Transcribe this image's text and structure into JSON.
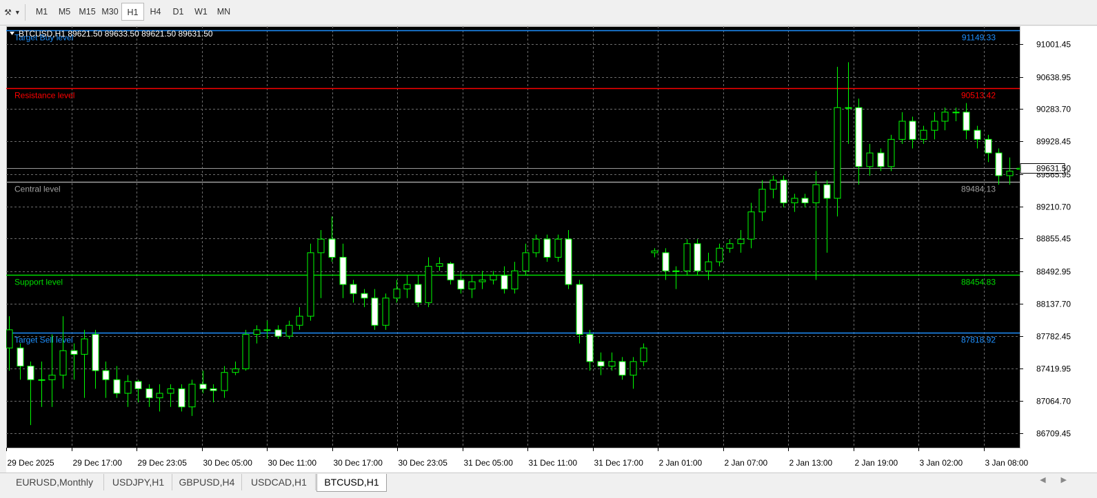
{
  "toolbar": {
    "tool_icon": "drawing-tools-icon",
    "timeframes": [
      "M1",
      "M5",
      "M15",
      "M30",
      "H1",
      "H4",
      "D1",
      "W1",
      "MN"
    ],
    "active_timeframe": "H1"
  },
  "chart_data": {
    "type": "candlestick",
    "symbol_header": "BTCUSD,H1  89621.50 89633.50 89621.50 89631.50",
    "current_price_label": "89631.50",
    "ylim": [
      86550,
      91160
    ],
    "y_ticks": [
      "91001.45",
      "90638.95",
      "90283.70",
      "89928.45",
      "89565.95",
      "89210.70",
      "88855.45",
      "88492.95",
      "88137.70",
      "87782.45",
      "87419.95",
      "87064.70",
      "86709.45"
    ],
    "x_ticks": [
      "29 Dec 2025",
      "29 Dec 17:00",
      "29 Dec 23:05",
      "30 Dec 05:00",
      "30 Dec 11:00",
      "30 Dec 17:00",
      "30 Dec 23:05",
      "31 Dec 05:00",
      "31 Dec 11:00",
      "31 Dec 17:00",
      "2 Jan 01:00",
      "2 Jan 07:00",
      "2 Jan 13:00",
      "2 Jan 19:00",
      "3 Jan 02:00",
      "3 Jan 08:00"
    ],
    "levels": [
      {
        "label": "Target Buy level",
        "value_text": "91149.33",
        "value": 91149.33,
        "color": "#1e90ff"
      },
      {
        "label": "Resistance level",
        "value_text": "90513.42",
        "value": 90513.42,
        "color": "#ff0000"
      },
      {
        "label": "Central level",
        "value_text": "89484.13",
        "value": 89484.13,
        "color": "#a0a0a0"
      },
      {
        "label": "Support level",
        "value_text": "88454.83",
        "value": 88454.83,
        "color": "#00dd00"
      },
      {
        "label": "Target Sell level",
        "value_text": "87818.92",
        "value": 87818.92,
        "color": "#1e90ff"
      }
    ],
    "candles": [
      [
        87650,
        87850,
        88000,
        87400
      ],
      [
        87650,
        87450,
        87700,
        87300
      ],
      [
        87450,
        87300,
        87500,
        86800
      ],
      [
        87300,
        87300,
        87500,
        87000
      ],
      [
        87300,
        87350,
        87800,
        87000
      ],
      [
        87350,
        87620,
        88000,
        87200
      ],
      [
        87620,
        87580,
        87700,
        87300
      ],
      [
        87580,
        87750,
        87850,
        87100
      ],
      [
        87800,
        87400,
        87850,
        87200
      ],
      [
        87400,
        87300,
        87500,
        87100
      ],
      [
        87300,
        87150,
        87450,
        87100
      ],
      [
        87150,
        87280,
        87350,
        87000
      ],
      [
        87280,
        87200,
        87300,
        87050
      ],
      [
        87200,
        87100,
        87250,
        87000
      ],
      [
        87100,
        87150,
        87250,
        86950
      ],
      [
        87150,
        87200,
        87250,
        87000
      ],
      [
        87200,
        87000,
        87250,
        86950
      ],
      [
        87000,
        87250,
        87300,
        86900
      ],
      [
        87250,
        87200,
        87400,
        87150
      ],
      [
        87200,
        87180,
        87250,
        87050
      ],
      [
        87180,
        87380,
        87450,
        87100
      ],
      [
        87380,
        87420,
        87500,
        87350
      ],
      [
        87420,
        87800,
        87850,
        87400
      ],
      [
        87800,
        87850,
        87900,
        87700
      ],
      [
        87850,
        87850,
        87950,
        87750
      ],
      [
        87850,
        87780,
        87900,
        87750
      ],
      [
        87780,
        87900,
        87950,
        87750
      ],
      [
        87900,
        88000,
        88100,
        87850
      ],
      [
        88000,
        88700,
        88800,
        87950
      ],
      [
        88700,
        88850,
        88950,
        88200
      ],
      [
        88850,
        88650,
        89100,
        88600
      ],
      [
        88650,
        88350,
        88800,
        88200
      ],
      [
        88350,
        88250,
        88400,
        88150
      ],
      [
        88250,
        88200,
        88300,
        88100
      ],
      [
        88200,
        87900,
        88300,
        87850
      ],
      [
        87900,
        88200,
        88250,
        87850
      ],
      [
        88200,
        88300,
        88400,
        88150
      ],
      [
        88300,
        88350,
        88450,
        88200
      ],
      [
        88350,
        88150,
        88450,
        88100
      ],
      [
        88150,
        88550,
        88650,
        88100
      ],
      [
        88550,
        88580,
        88650,
        88500
      ],
      [
        88580,
        88400,
        88600,
        88350
      ],
      [
        88400,
        88300,
        88500,
        88250
      ],
      [
        88300,
        88380,
        88450,
        88200
      ],
      [
        88380,
        88400,
        88500,
        88300
      ],
      [
        88400,
        88450,
        88500,
        88350
      ],
      [
        88450,
        88300,
        88550,
        88250
      ],
      [
        88300,
        88500,
        88600,
        88250
      ],
      [
        88500,
        88700,
        88800,
        88450
      ],
      [
        88700,
        88850,
        88900,
        88650
      ],
      [
        88850,
        88650,
        88900,
        88600
      ],
      [
        88650,
        88850,
        88900,
        88600
      ],
      [
        88850,
        88350,
        88950,
        88300
      ],
      [
        88350,
        87800,
        88400,
        87700
      ],
      [
        87800,
        87500,
        87850,
        87400
      ],
      [
        87500,
        87450,
        87600,
        87350
      ],
      [
        87450,
        87500,
        87600,
        87400
      ],
      [
        87500,
        87350,
        87550,
        87300
      ],
      [
        87350,
        87500,
        87550,
        87200
      ],
      [
        87500,
        87650,
        87700,
        87450
      ],
      [
        88700,
        88720,
        88750,
        88650
      ],
      [
        88700,
        88500,
        88750,
        88400
      ],
      [
        88500,
        88500,
        88550,
        88300
      ],
      [
        88500,
        88800,
        88850,
        88450
      ],
      [
        88800,
        88500,
        88850,
        88450
      ],
      [
        88500,
        88600,
        88700,
        88400
      ],
      [
        88600,
        88750,
        88800,
        88550
      ],
      [
        88750,
        88800,
        88850,
        88700
      ],
      [
        88800,
        88850,
        88950,
        88700
      ],
      [
        88850,
        89150,
        89250,
        88750
      ],
      [
        89150,
        89400,
        89500,
        89050
      ],
      [
        89400,
        89500,
        89550,
        89300
      ],
      [
        89500,
        89250,
        89550,
        89200
      ],
      [
        89250,
        89300,
        89350,
        89150
      ],
      [
        89300,
        89250,
        89350,
        89200
      ],
      [
        89250,
        89450,
        89600,
        88400
      ],
      [
        89450,
        89300,
        89500,
        88700
      ],
      [
        89300,
        90300,
        90750,
        89100
      ],
      [
        90300,
        90300,
        90800,
        89900
      ],
      [
        90300,
        89650,
        90400,
        89450
      ],
      [
        89650,
        89800,
        89900,
        89550
      ],
      [
        89800,
        89650,
        89850,
        89600
      ],
      [
        89650,
        89950,
        90000,
        89600
      ],
      [
        89950,
        90150,
        90250,
        89900
      ],
      [
        90150,
        89950,
        90200,
        89850
      ],
      [
        89950,
        90050,
        90100,
        89900
      ],
      [
        90050,
        90150,
        90250,
        89950
      ],
      [
        90150,
        90250,
        90300,
        90050
      ],
      [
        90250,
        90250,
        90300,
        90150
      ],
      [
        90250,
        90050,
        90350,
        89950
      ],
      [
        90050,
        89950,
        90100,
        89850
      ],
      [
        89950,
        89800,
        90000,
        89700
      ],
      [
        89800,
        89550,
        89850,
        89450
      ],
      [
        89550,
        89600,
        89750,
        89450
      ],
      [
        89620,
        89631.5,
        89660,
        89600
      ]
    ]
  },
  "tabs": {
    "items": [
      "EURUSD,Monthly",
      "USDJPY,H1",
      "GBPUSD,H4",
      "USDCAD,H1",
      "BTCUSD,H1"
    ],
    "active": "BTCUSD,H1",
    "scroll_left": "◀",
    "scroll_right": "▶"
  }
}
